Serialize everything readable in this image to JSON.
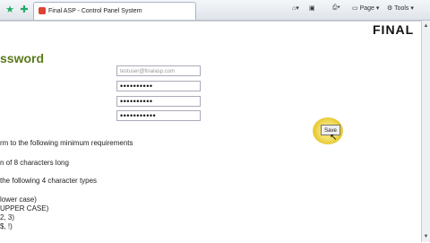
{
  "browser": {
    "tab_title": "Final ASP - Control Panel System",
    "tools": {
      "page": "Page",
      "tools": "Tools"
    }
  },
  "page": {
    "brand": "FINAL",
    "heading": "ssword",
    "email_value": "testuser@finalasp.com",
    "password_mask": "••••••••••",
    "confirm_mask": "••••••••••",
    "third_mask": "•••••••••••",
    "save_label": "Save",
    "requirements": [
      "rm to the following minimum requirements",
      "n of 8 characters long",
      "the following 4 character types",
      "lower case)",
      "UPPER CASE)",
      " 2, 3)",
      " $, !)"
    ]
  }
}
